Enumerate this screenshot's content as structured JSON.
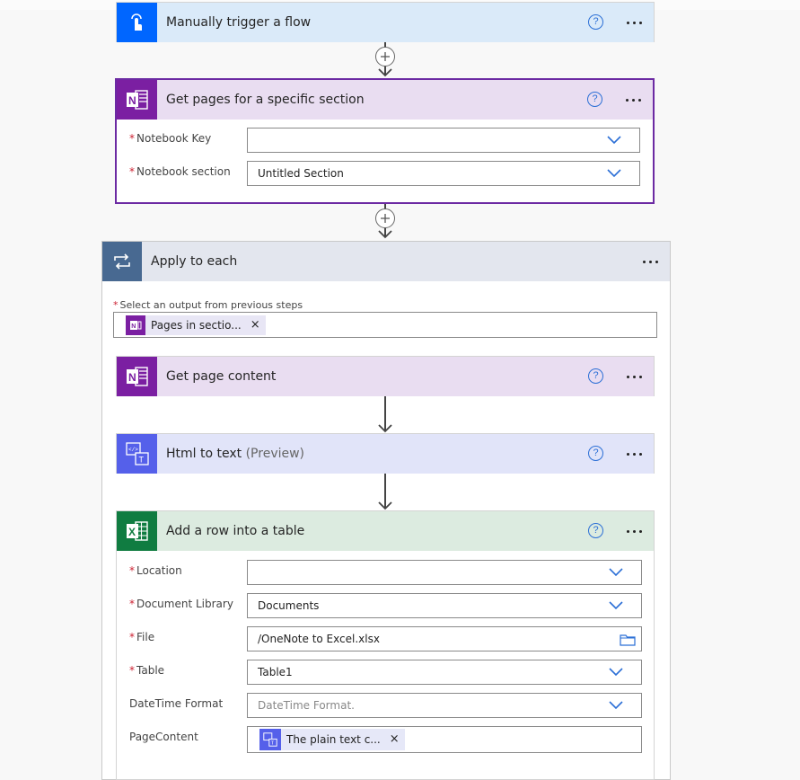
{
  "steps": {
    "trigger": {
      "title": "Manually trigger a flow",
      "icon": "touch-hand-icon",
      "help": "?"
    },
    "get_pages": {
      "title": "Get pages for a specific section",
      "icon": "onenote-icon",
      "help": "?",
      "fields": [
        {
          "label": "Notebook Key",
          "required": "*",
          "value": ""
        },
        {
          "label": "Notebook section",
          "required": "*",
          "value": "Untitled Section"
        }
      ]
    },
    "apply_each": {
      "title": "Apply to each",
      "icon": "loop-icon",
      "select_label": "Select an output from previous steps",
      "required": "*",
      "token": "Pages in sectio...",
      "token_close": "×"
    },
    "get_content": {
      "title": "Get page content",
      "icon": "onenote-icon",
      "help": "?"
    },
    "html_to_text": {
      "title": "Html to text",
      "preview": "(Preview)",
      "icon": "html-to-text-icon",
      "help": "?"
    },
    "add_row": {
      "title": "Add a row into a table",
      "icon": "excel-icon",
      "help": "?",
      "fields": [
        {
          "label": "Location",
          "required": "*",
          "value": ""
        },
        {
          "label": "Document Library",
          "required": "*",
          "value": "Documents"
        },
        {
          "label": "File",
          "required": "*",
          "value": "/OneNote to Excel.xlsx"
        },
        {
          "label": "Table",
          "required": "*",
          "value": "Table1"
        },
        {
          "label": "DateTime Format",
          "required": "",
          "value": "",
          "placeholder": "DateTime Format."
        },
        {
          "label": "PageContent",
          "required": "",
          "token": "The plain text c...",
          "token_close": "×"
        }
      ]
    }
  },
  "colors": {
    "trigger_header": "#daeaf9",
    "trigger_icon": "#0066ff",
    "onenote_header": "#e9ddf1",
    "onenote_icon": "#7b1fa2",
    "apply_header": "#e3e6ee",
    "apply_icon": "#486991",
    "html_header": "#e1e4f9",
    "html_icon": "#5560ea",
    "excel_header": "#dcebe0",
    "excel_icon": "#107c41",
    "selected_border": "#6c2aa3",
    "accent": "#2b6fd6"
  }
}
